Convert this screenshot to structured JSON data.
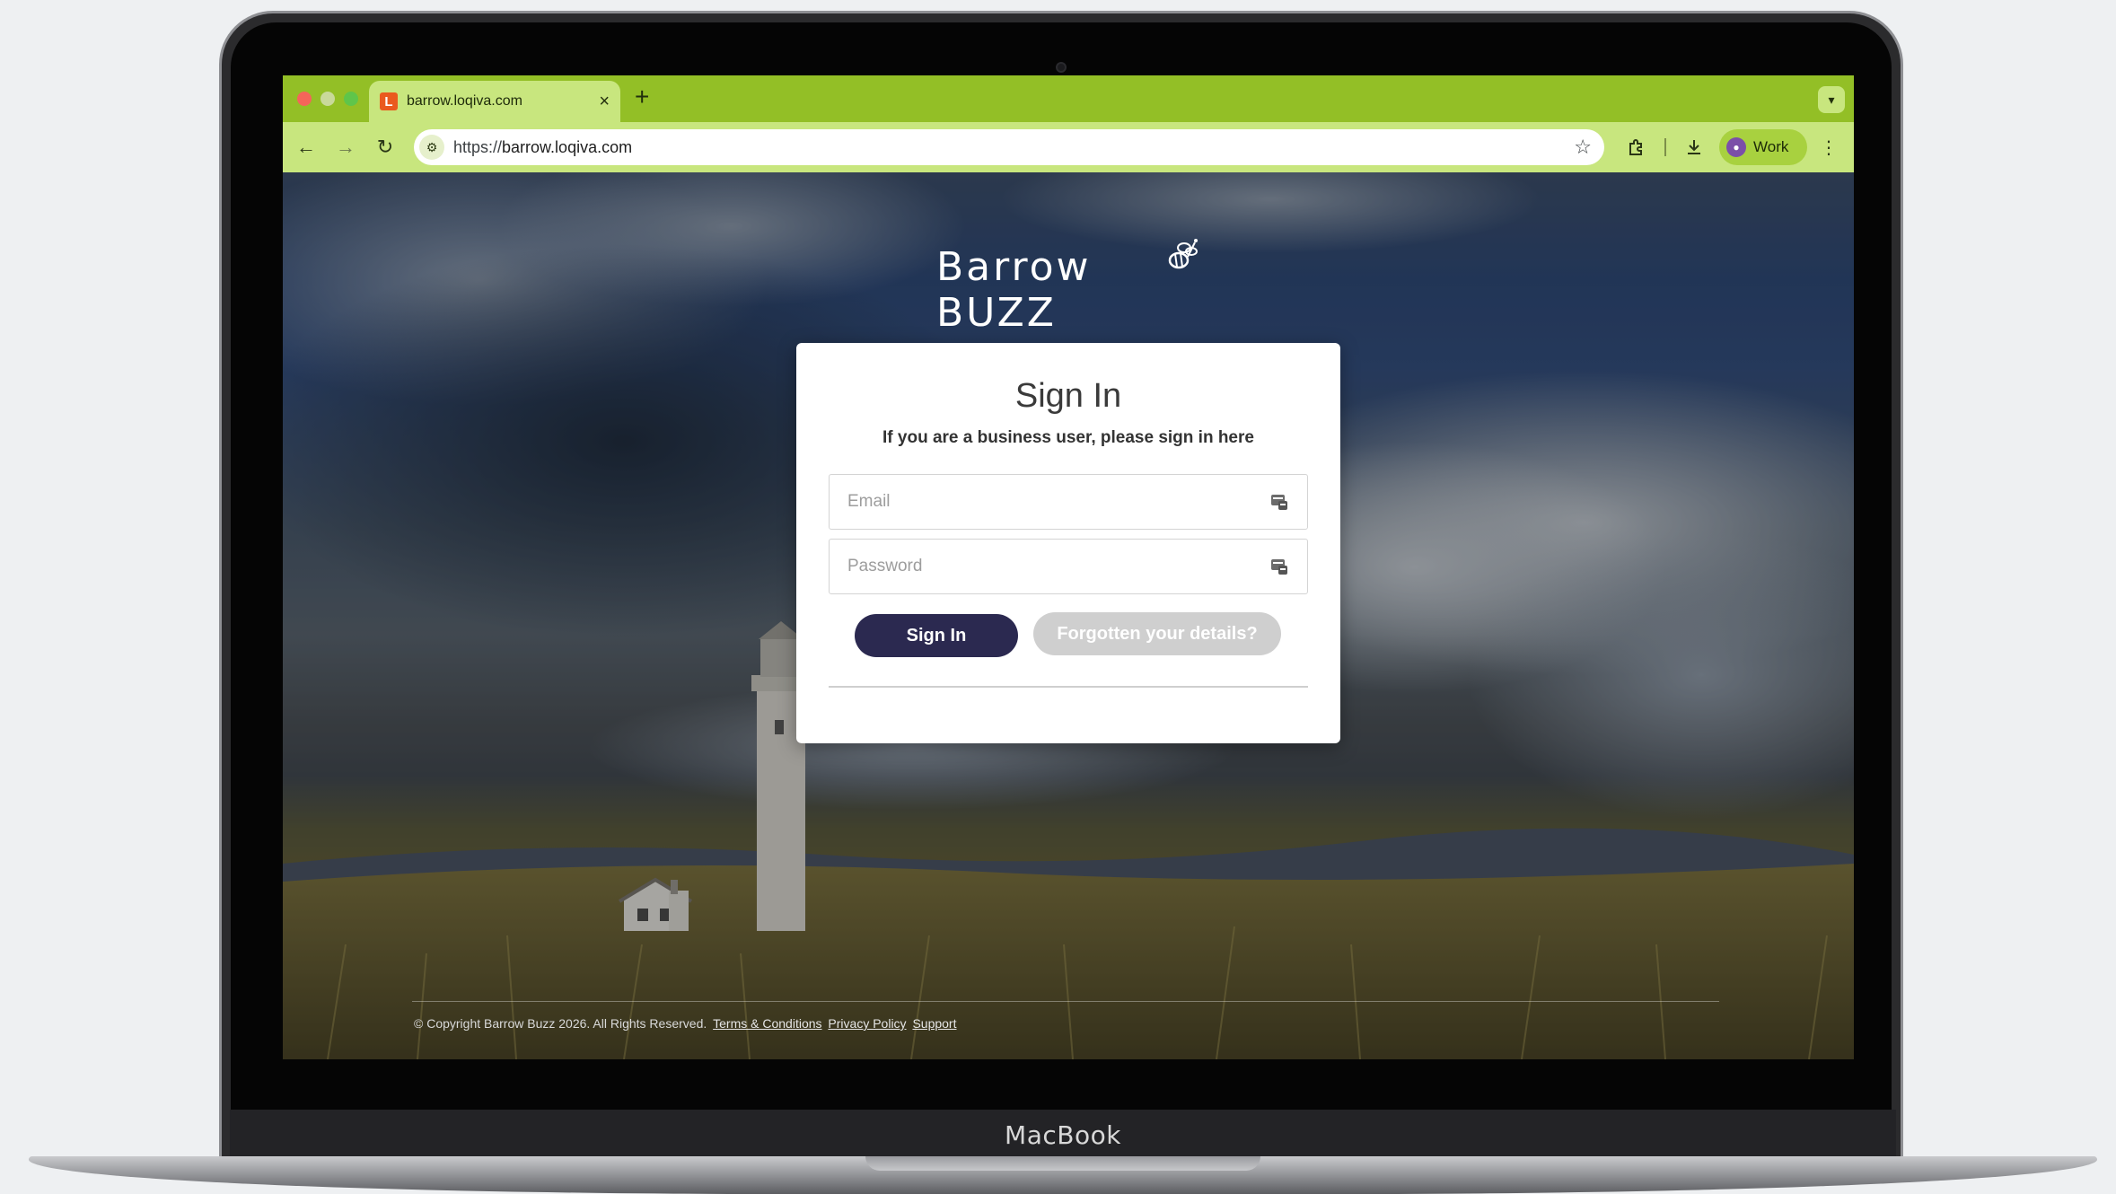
{
  "browser": {
    "tab_title": "barrow.loqiva.com",
    "tab_favicon_letter": "L",
    "new_tab_symbol": "+",
    "url_scheme": "https://",
    "url_host": "barrow.loqiva.com",
    "profile_label": "Work",
    "chrome_color": "#93bf26",
    "toolbar_color": "#c8e67e"
  },
  "page": {
    "logo_text": "Barrow BUZZ",
    "title": "Sign In",
    "subtitle": "If you are a business user, please sign in here",
    "email_placeholder": "Email",
    "password_placeholder": "Password",
    "signin_label": "Sign In",
    "forgot_label": "Forgotten your details?",
    "signin_color": "#2b2950"
  },
  "footer": {
    "copyright": "© Copyright Barrow Buzz 2026. All Rights Reserved.",
    "links": [
      "Terms & Conditions",
      "Privacy Policy",
      "Support"
    ]
  },
  "device": {
    "label": "MacBook"
  }
}
